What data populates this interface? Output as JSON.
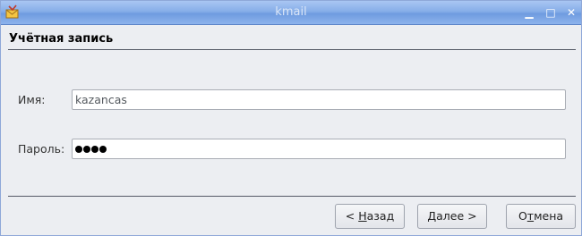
{
  "window": {
    "title": "kmail",
    "app_icon": "kmail-app-icon",
    "controls": {
      "minimize": "▁",
      "maximize": "□",
      "close": "✕"
    }
  },
  "page": {
    "title": "Учётная запись"
  },
  "form": {
    "name_label": "Имя:",
    "name_value": "kazancas",
    "password_label": "Пароль:",
    "password_mask_count": 4
  },
  "buttons": {
    "back": {
      "prefix": "< ",
      "mnemonic": "Н",
      "rest": "азад"
    },
    "next": {
      "prefix": "",
      "mnemonic": "Д",
      "rest": "алее >"
    },
    "cancel": {
      "prefix": "О",
      "mnemonic": "т",
      "rest": "мена"
    }
  },
  "colors": {
    "titlebar": "#86aee8",
    "background": "#eceef2"
  }
}
